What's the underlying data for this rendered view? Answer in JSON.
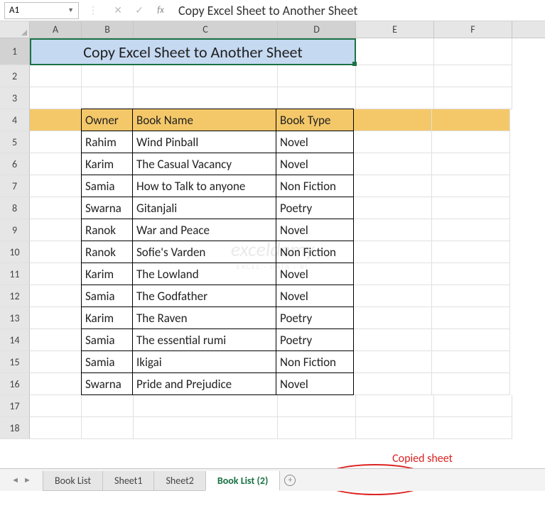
{
  "nameBox": "A1",
  "formulaBarText": "Copy Excel Sheet to Another Sheet",
  "columns": [
    "A",
    "B",
    "C",
    "D",
    "E",
    "F"
  ],
  "selectedCols": [
    "A",
    "B",
    "C",
    "D"
  ],
  "rowCount": 18,
  "selectedRow": 1,
  "title": "Copy Excel Sheet to Another Sheet",
  "tableHeader": {
    "owner": "Owner",
    "book": "Book Name",
    "type": "Book Type"
  },
  "tableRows": [
    {
      "owner": "Rahim",
      "book": "Wind Pinball",
      "type": "Novel"
    },
    {
      "owner": "Karim",
      "book": "The Casual Vacancy",
      "type": "Novel"
    },
    {
      "owner": "Samia",
      "book": "How to Talk to anyone",
      "type": "Non Fiction"
    },
    {
      "owner": "Swarna",
      "book": "Gitanjali",
      "type": "Poetry"
    },
    {
      "owner": "Ranok",
      "book": "War and Peace",
      "type": "Novel"
    },
    {
      "owner": "Ranok",
      "book": "Sofie's Varden",
      "type": "Non Fiction"
    },
    {
      "owner": "Karim",
      "book": "The Lowland",
      "type": "Novel"
    },
    {
      "owner": "Samia",
      "book": "The Godfather",
      "type": "Novel"
    },
    {
      "owner": "Karim",
      "book": "The Raven",
      "type": "Poetry"
    },
    {
      "owner": "Samia",
      "book": "The essential rumi",
      "type": "Poetry"
    },
    {
      "owner": "Samia",
      "book": "Ikigai",
      "type": "Non Fiction"
    },
    {
      "owner": "Swarna",
      "book": "Pride and Prejudice",
      "type": "Novel"
    }
  ],
  "sheetTabs": [
    {
      "label": "Book List",
      "active": false
    },
    {
      "label": "Sheet1",
      "active": false
    },
    {
      "label": "Sheet2",
      "active": false
    },
    {
      "label": "Book List (2)",
      "active": true
    }
  ],
  "annotation": "Copied sheet",
  "watermark": {
    "big": "exceldemy",
    "small": "EXCEL · DATA · BI"
  }
}
